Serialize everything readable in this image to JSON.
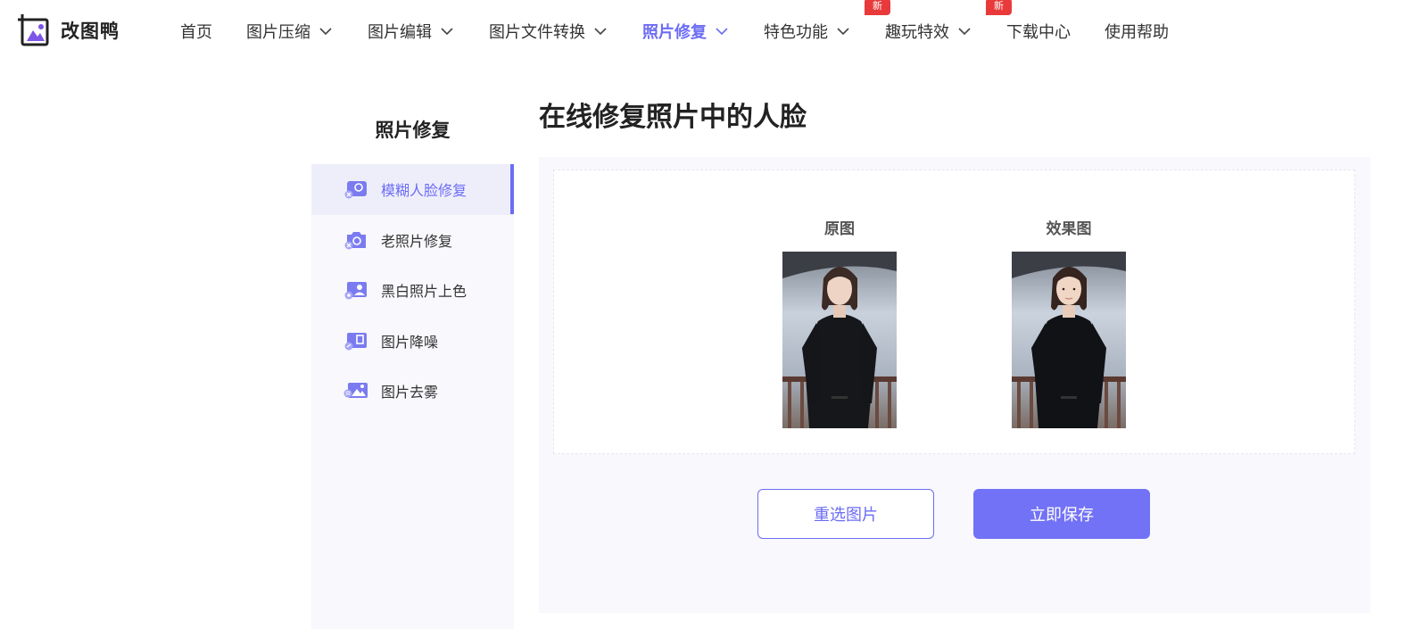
{
  "app": {
    "logo_text": "改图鸭"
  },
  "nav": {
    "items": [
      {
        "label": "首页",
        "dropdown": false
      },
      {
        "label": "图片压缩",
        "dropdown": true
      },
      {
        "label": "图片编辑",
        "dropdown": true
      },
      {
        "label": "图片文件转换",
        "dropdown": true
      },
      {
        "label": "照片修复",
        "dropdown": true,
        "active": true
      },
      {
        "label": "特色功能",
        "dropdown": true,
        "badge": "新"
      },
      {
        "label": "趣玩特效",
        "dropdown": true,
        "badge": "新"
      },
      {
        "label": "下载中心",
        "dropdown": false
      },
      {
        "label": "使用帮助",
        "dropdown": false
      }
    ]
  },
  "sidebar": {
    "title": "照片修复",
    "items": [
      {
        "label": "模糊人脸修复",
        "icon": "blur-face-icon",
        "active": true
      },
      {
        "label": "老照片修复",
        "icon": "old-photo-icon"
      },
      {
        "label": "黑白照片上色",
        "icon": "colorize-icon"
      },
      {
        "label": "图片降噪",
        "icon": "denoise-icon"
      },
      {
        "label": "图片去雾",
        "icon": "dehaze-icon"
      }
    ]
  },
  "main": {
    "title": "在线修复照片中的人脸",
    "original_label": "原图",
    "result_label": "效果图",
    "reselect_button": "重选图片",
    "save_button": "立即保存"
  },
  "colors": {
    "accent": "#6c6cf5",
    "badge": "#e83a3a",
    "panel_bg": "#f8f8fd"
  }
}
